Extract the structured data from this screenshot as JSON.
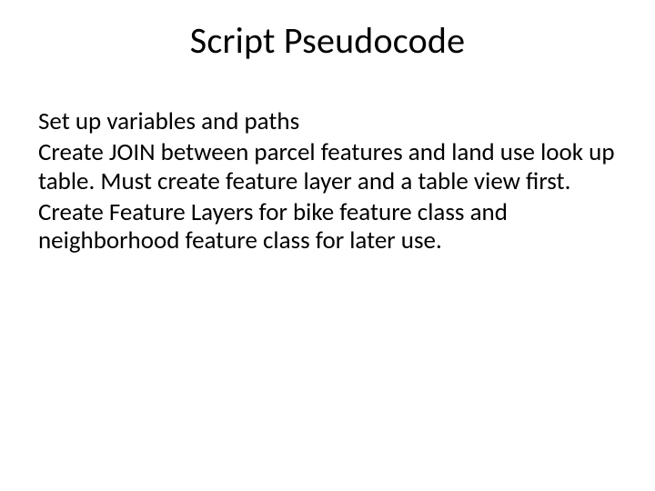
{
  "slide": {
    "title": "Script Pseudocode",
    "paragraphs": [
      "Set up variables and paths",
      "Create JOIN between parcel features and land use look up table.  Must create feature layer and a table view first.",
      "Create Feature Layers for bike feature class and neighborhood feature class for later use."
    ]
  }
}
